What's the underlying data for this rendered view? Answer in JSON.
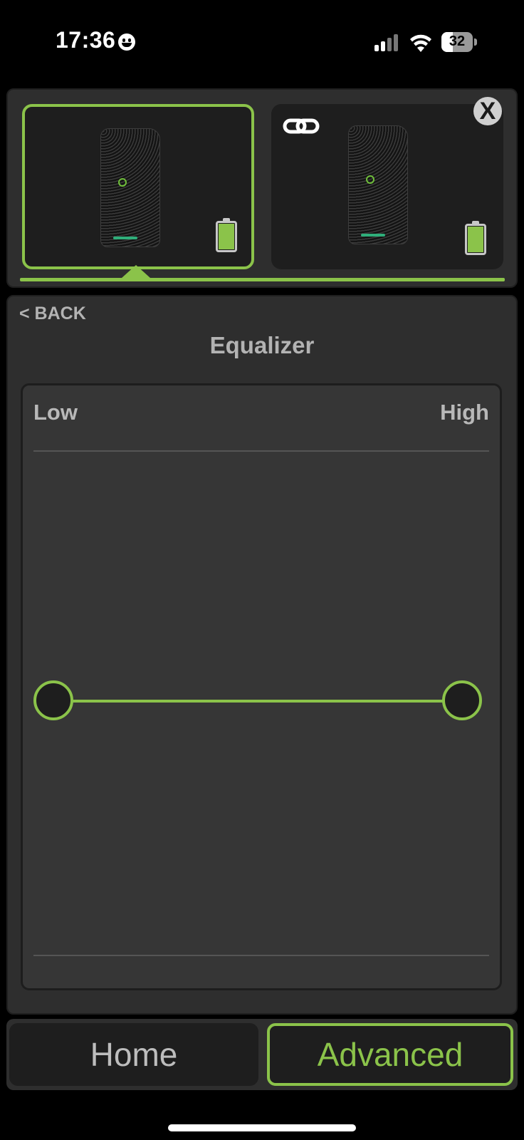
{
  "status_bar": {
    "time": "17:36",
    "battery_level": "32"
  },
  "speakers": {
    "selected_card": {
      "battery_icon": "battery-full-icon"
    },
    "linked_card": {
      "link_icon": "link-chain-icon",
      "battery_icon": "battery-full-icon"
    },
    "close_label": "X"
  },
  "equalizer": {
    "back_label": "< BACK",
    "title": "Equalizer",
    "low_label": "Low",
    "high_label": "High"
  },
  "tabs": {
    "home_label": "Home",
    "advanced_label": "Advanced",
    "active": "Advanced"
  },
  "colors": {
    "accent": "#8bc34a",
    "panel": "#2e2e2e",
    "card": "#1e1e1e"
  }
}
